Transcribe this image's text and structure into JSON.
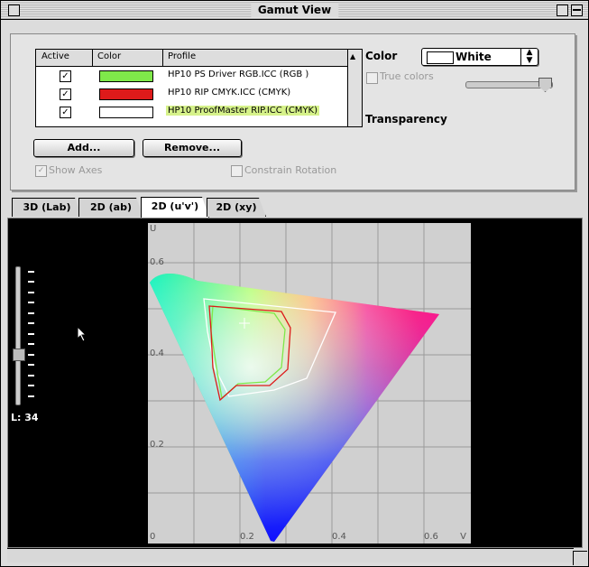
{
  "window": {
    "title": "Gamut View"
  },
  "profiles_table": {
    "headers": {
      "active": "Active",
      "color": "Color",
      "profile": "Profile"
    },
    "rows": [
      {
        "active": true,
        "color": "#7fe84a",
        "profile": "HP10 PS Driver RGB.ICC (RGB )"
      },
      {
        "active": true,
        "color": "#dd1a1a",
        "profile": "HP10 RIP CMYK.ICC (CMYK)"
      },
      {
        "active": true,
        "color": "#ffffff",
        "profile": "HP10 ProofMaster RIP.ICC (CMYK)"
      }
    ]
  },
  "buttons": {
    "add": "Add...",
    "remove": "Remove..."
  },
  "options": {
    "show_axes": {
      "label": "Show Axes",
      "checked": true
    },
    "constrain_rotation": {
      "label": "Constrain Rotation",
      "checked": false
    },
    "true_colors": {
      "label": "True colors",
      "checked": false
    }
  },
  "color_control": {
    "label": "Color",
    "value": "White"
  },
  "transparency": {
    "label": "Transparency",
    "value": 1.0
  },
  "tabs": [
    "3D (Lab)",
    "2D (ab)",
    "2D (u'v')",
    "2D (xy)"
  ],
  "active_tab": 2,
  "lightness": {
    "label": "L: 34",
    "value": 34
  },
  "plot": {
    "x_axis_label": "V",
    "y_axis_label": "U",
    "x_ticks": [
      "0",
      "0.2",
      "0.4",
      "0.6"
    ],
    "y_ticks": [
      "0.6",
      "0.4",
      "0.2"
    ]
  },
  "colors": {
    "highlight": "#d6f28a",
    "rgb_gamut": "#7fe84a",
    "rip_gamut": "#dd1a1a",
    "proof_gamut": "#ffffff"
  }
}
